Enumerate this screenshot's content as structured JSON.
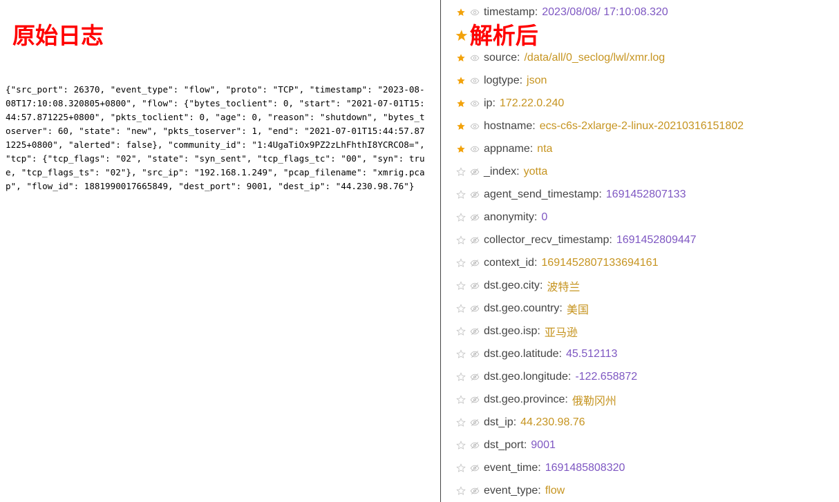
{
  "left_panel": {
    "title": "原始日志",
    "raw_log": "{\"src_port\": 26370, \"event_type\": \"flow\", \"proto\": \"TCP\", \"timestamp\": \"2023-08-08T17:10:08.320805+0800\", \"flow\": {\"bytes_toclient\": 0, \"start\": \"2021-07-01T15:44:57.871225+0800\", \"pkts_toclient\": 0, \"age\": 0, \"reason\": \"shutdown\", \"bytes_toserver\": 60, \"state\": \"new\", \"pkts_toserver\": 1, \"end\": \"2021-07-01T15:44:57.871225+0800\", \"alerted\": false}, \"community_id\": \"1:4UgaTiOx9PZ2zLhFhthI8YCRCO8=\", \"tcp\": {\"tcp_flags\": \"02\", \"state\": \"syn_sent\", \"tcp_flags_tc\": \"00\", \"syn\": true, \"tcp_flags_ts\": \"02\"}, \"src_ip\": \"192.168.1.249\", \"pcap_filename\": \"xmrig.pcap\", \"flow_id\": 1881990017665849, \"dest_port\": 9001, \"dest_ip\": \"44.230.98.76\"}"
  },
  "right_panel": {
    "title": "解析后",
    "separator": ":",
    "colors": {
      "star_filled": "#f2a20b",
      "star_empty": "#c8c8c8",
      "eye": "#bdbdbd",
      "string_value": "#c69420",
      "number_value": "#7e57c2"
    },
    "fields": [
      {
        "key": "timestamp",
        "value": "2023/08/08/ 17:10:08.320",
        "type": "num",
        "starred": true,
        "visible": true
      },
      {
        "key": "",
        "value": "",
        "type": "str",
        "starred": true,
        "visible": true
      },
      {
        "key": "source",
        "value": "/data/all/0_seclog/lwl/xmr.log",
        "type": "str",
        "starred": true,
        "visible": true
      },
      {
        "key": "logtype",
        "value": "json",
        "type": "str",
        "starred": true,
        "visible": true
      },
      {
        "key": "ip",
        "value": "172.22.0.240",
        "type": "str",
        "starred": true,
        "visible": true
      },
      {
        "key": "hostname",
        "value": "ecs-c6s-2xlarge-2-linux-20210316151802",
        "type": "str",
        "starred": true,
        "visible": true
      },
      {
        "key": "appname",
        "value": "nta",
        "type": "str",
        "starred": true,
        "visible": true
      },
      {
        "key": "_index",
        "value": "yotta",
        "type": "str",
        "starred": false,
        "visible": false
      },
      {
        "key": "agent_send_timestamp",
        "value": "1691452807133",
        "type": "num",
        "starred": false,
        "visible": false
      },
      {
        "key": "anonymity",
        "value": "0",
        "type": "num",
        "starred": false,
        "visible": false
      },
      {
        "key": "collector_recv_timestamp",
        "value": "1691452809447",
        "type": "num",
        "starred": false,
        "visible": false
      },
      {
        "key": "context_id",
        "value": "1691452807133694161",
        "type": "str",
        "starred": false,
        "visible": false
      },
      {
        "key": "dst.geo.city",
        "value": "波特兰",
        "type": "str",
        "starred": false,
        "visible": false
      },
      {
        "key": "dst.geo.country",
        "value": "美国",
        "type": "str",
        "starred": false,
        "visible": false
      },
      {
        "key": "dst.geo.isp",
        "value": "亚马逊",
        "type": "str",
        "starred": false,
        "visible": false
      },
      {
        "key": "dst.geo.latitude",
        "value": "45.512113",
        "type": "num",
        "starred": false,
        "visible": false
      },
      {
        "key": "dst.geo.longitude",
        "value": "-122.658872",
        "type": "num",
        "starred": false,
        "visible": false
      },
      {
        "key": "dst.geo.province",
        "value": "俄勒冈州",
        "type": "str",
        "starred": false,
        "visible": false
      },
      {
        "key": "dst_ip",
        "value": "44.230.98.76",
        "type": "str",
        "starred": false,
        "visible": false
      },
      {
        "key": "dst_port",
        "value": "9001",
        "type": "num",
        "starred": false,
        "visible": false
      },
      {
        "key": "event_time",
        "value": "1691485808320",
        "type": "num",
        "starred": false,
        "visible": false
      },
      {
        "key": "event_type",
        "value": "flow",
        "type": "str",
        "starred": false,
        "visible": false
      }
    ]
  }
}
